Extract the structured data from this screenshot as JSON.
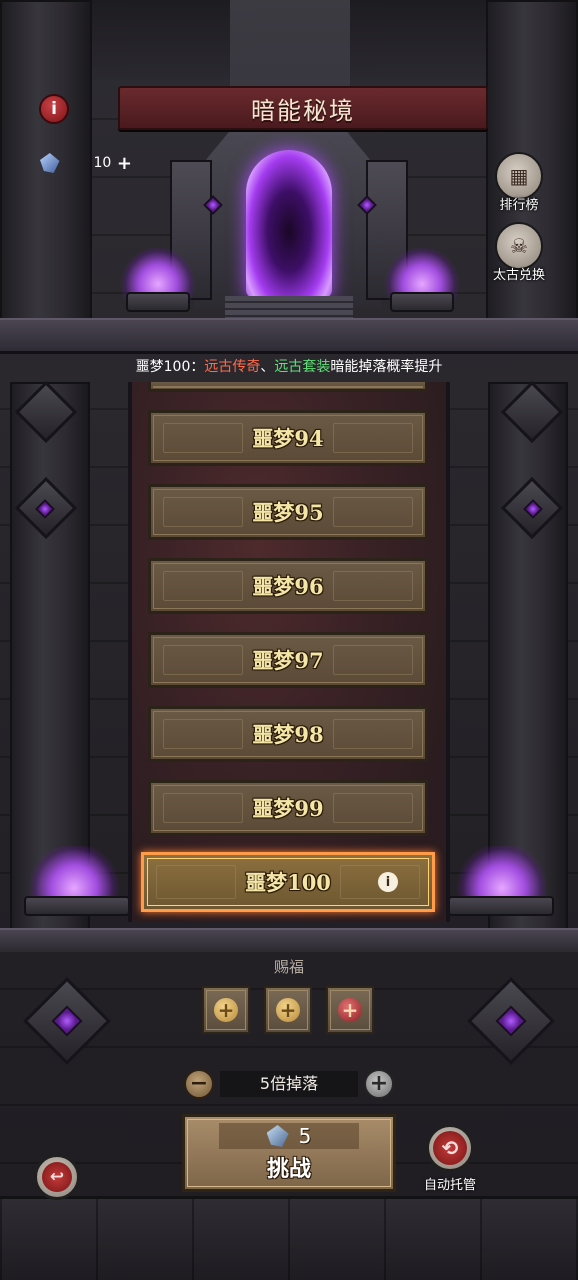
{
  "header": {
    "title": "暗能秘境",
    "currency_value": "10",
    "currency_plus": "+",
    "info_glyph": "i"
  },
  "side_buttons": {
    "ranking_label": "排行榜",
    "exchange_label": "太古兑换"
  },
  "notice": {
    "prefix": "噩梦100：",
    "item1": "远古传奇",
    "separator": "、",
    "item2": "远古套装",
    "suffix": "暗能掉落概率提升",
    "colors": {
      "highlight1": "#ff6b4a",
      "highlight2": "#5fe07a"
    }
  },
  "levels": [
    {
      "label": "噩梦94"
    },
    {
      "label": "噩梦95"
    },
    {
      "label": "噩梦96"
    },
    {
      "label": "噩梦97"
    },
    {
      "label": "噩梦98"
    },
    {
      "label": "噩梦99"
    },
    {
      "label": "噩梦100",
      "selected": true
    }
  ],
  "blessing": {
    "title": "赐福",
    "slots": [
      {
        "icon": "plus-icon"
      },
      {
        "icon": "plus-icon"
      },
      {
        "icon": "plus-potion-icon"
      }
    ]
  },
  "drop": {
    "minus": "−",
    "label": "5倍掉落",
    "plus": "+"
  },
  "challenge": {
    "cost": "5",
    "label": "挑战"
  },
  "auto": {
    "label": "自动托管"
  },
  "icons": {
    "back": "back-arrow-icon",
    "auto": "auto-cycle-icon",
    "info": "info-icon",
    "crystal": "crystal-icon"
  }
}
